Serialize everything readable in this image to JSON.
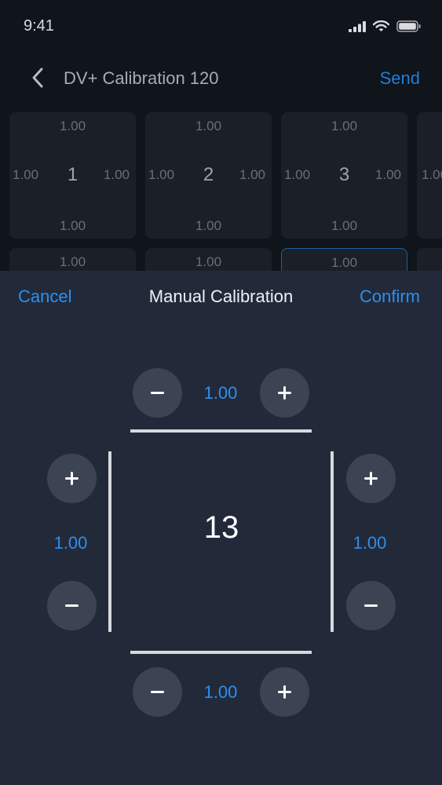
{
  "status": {
    "time": "9:41"
  },
  "nav": {
    "title": "DV+ Calibration 120",
    "send_label": "Send"
  },
  "grid": {
    "cells": [
      {
        "number": "1",
        "top": "1.00",
        "bottom": "1.00",
        "left": "1.00",
        "right": "1.00"
      },
      {
        "number": "2",
        "top": "1.00",
        "bottom": "1.00",
        "left": "1.00",
        "right": "1.00"
      },
      {
        "number": "3",
        "top": "1.00",
        "bottom": "1.00",
        "left": "1.00",
        "right": "1.00"
      },
      {
        "number": "",
        "top": "",
        "bottom": "",
        "left": "1.00",
        "right": ""
      },
      {
        "number": "",
        "top": "1.00",
        "bottom": "",
        "left": "",
        "right": ""
      },
      {
        "number": "",
        "top": "1.00",
        "bottom": "",
        "left": "",
        "right": ""
      },
      {
        "number": "",
        "top": "1.00",
        "bottom": "",
        "left": "",
        "right": ""
      }
    ]
  },
  "sheet": {
    "title": "Manual Calibration",
    "cancel_label": "Cancel",
    "confirm_label": "Confirm",
    "cell_number": "13",
    "top_value": "1.00",
    "bottom_value": "1.00",
    "left_value": "1.00",
    "right_value": "1.00"
  },
  "icons": {
    "minus": "minus-icon",
    "plus": "plus-icon",
    "back": "chevron-left-icon"
  },
  "colors": {
    "accent": "#2d8ef0",
    "sheet_bg": "#222a3a",
    "button_bg": "#3c4453",
    "page_bg": "#10141b"
  }
}
